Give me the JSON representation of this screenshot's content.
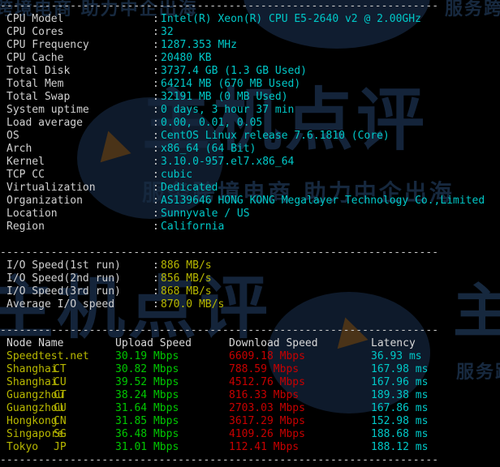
{
  "terminal": {
    "separator": "---------------------------------------------------------------------",
    "sysinfo": [
      {
        "label": "CPU Model",
        "value": "Intel(R) Xeon(R) CPU E5-2640 v2 @ 2.00GHz"
      },
      {
        "label": "CPU Cores",
        "value": "32"
      },
      {
        "label": "CPU Frequency",
        "value": "1287.353 MHz"
      },
      {
        "label": "CPU Cache",
        "value": "20480 KB"
      },
      {
        "label": "Total Disk",
        "value": "3737.4 GB (1.3 GB Used)"
      },
      {
        "label": "Total Mem",
        "value": "64214 MB (670 MB Used)"
      },
      {
        "label": "Total Swap",
        "value": "32191 MB (0 MB Used)"
      },
      {
        "label": "System uptime",
        "value": "0 days, 3 hour 37 min"
      },
      {
        "label": "Load average",
        "value": "0.00, 0.01, 0.05"
      },
      {
        "label": "OS",
        "value": "CentOS Linux release 7.6.1810 (Core)"
      },
      {
        "label": "Arch",
        "value": "x86_64 (64 Bit)"
      },
      {
        "label": "Kernel",
        "value": "3.10.0-957.el7.x86_64"
      },
      {
        "label": "TCP CC",
        "value": "cubic"
      },
      {
        "label": "Virtualization",
        "value": "Dedicated"
      },
      {
        "label": "Organization",
        "value": "AS139646 HONG KONG Megalayer Technology Co.,Limited"
      },
      {
        "label": "Location",
        "value": "Sunnyvale / US"
      },
      {
        "label": "Region",
        "value": "California"
      }
    ],
    "iospeed": [
      {
        "label": "I/O Speed(1st run)",
        "value": "886 MB/s"
      },
      {
        "label": "I/O Speed(2nd run)",
        "value": "856 MB/s"
      },
      {
        "label": "I/O Speed(3rd run)",
        "value": "868 MB/s"
      },
      {
        "label": "Average I/O speed",
        "value": "870.0 MB/s"
      }
    ],
    "speedtest": {
      "headers": {
        "node": "Node Name",
        "isp": "",
        "upload": "Upload Speed",
        "download": "Download Speed",
        "latency": "Latency"
      },
      "rows": [
        {
          "node": "Speedtest.net",
          "isp": "",
          "upload": "30.19 Mbps",
          "download": "6609.18 Mbps",
          "latency": "36.93 ms"
        },
        {
          "node": "Shanghai",
          "isp": "CT",
          "upload": "30.82 Mbps",
          "download": "788.59 Mbps",
          "latency": "167.98 ms"
        },
        {
          "node": "Shanghai",
          "isp": "CU",
          "upload": "39.52 Mbps",
          "download": "4512.76 Mbps",
          "latency": "167.96 ms"
        },
        {
          "node": "Guangzhou",
          "isp": "CT",
          "upload": "38.24 Mbps",
          "download": "816.33 Mbps",
          "latency": "189.38 ms"
        },
        {
          "node": "Guangzhou",
          "isp": "CU",
          "upload": "31.64 Mbps",
          "download": "2703.03 Mbps",
          "latency": "167.86 ms"
        },
        {
          "node": "Hongkong",
          "isp": "CN",
          "upload": "31.85 Mbps",
          "download": "3617.29 Mbps",
          "latency": "152.98 ms"
        },
        {
          "node": "Singapore",
          "isp": "SG",
          "upload": "36.48 Mbps",
          "download": "4109.26 Mbps",
          "latency": "188.68 ms"
        },
        {
          "node": "Tokyo",
          "isp": "JP",
          "upload": "31.01 Mbps",
          "download": "112.41 Mbps",
          "latency": "188.12 ms"
        }
      ]
    }
  },
  "watermark": {
    "top_left": "跨境电商  助力中企出海",
    "top_right": "服务跨",
    "center_big": "主机点评",
    "center_mid": "服务跨境电商  助力中企出海",
    "bottom_left": "主机点评",
    "bottom_right": "主",
    "bottom_right2": "服务跨"
  },
  "colors": {
    "background": "#000000",
    "label": "#d0d0d0",
    "value_cyan": "#00c8c8",
    "io_yellow": "#b8b800",
    "upload_green": "#00c800",
    "download_red": "#c80000",
    "separator": "#c8c8c8",
    "watermark": "#1a2d45"
  }
}
